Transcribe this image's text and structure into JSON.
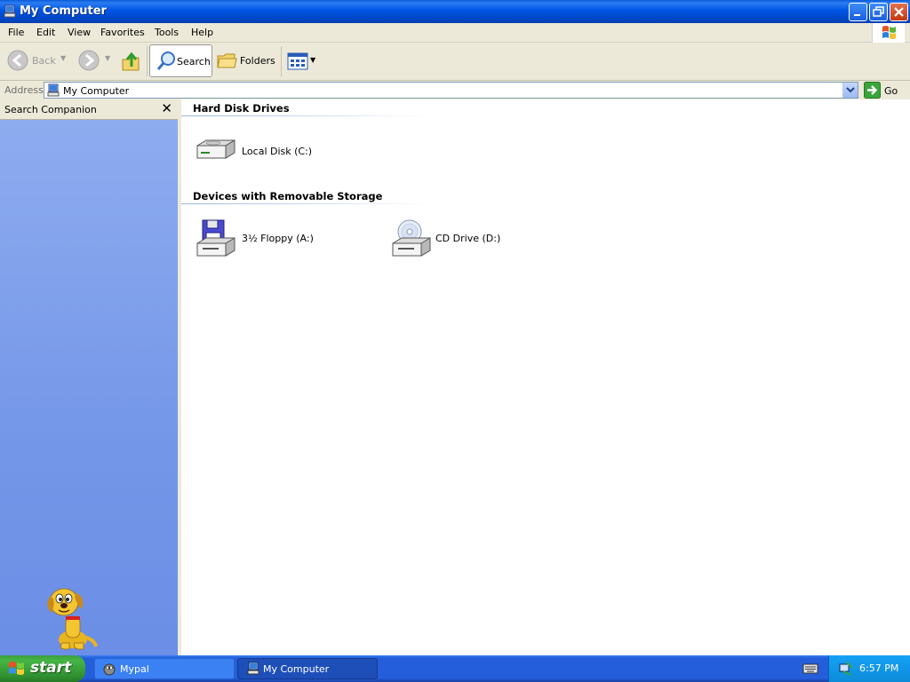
{
  "window": {
    "title": "My Computer",
    "icon": "computer-icon"
  },
  "menu": {
    "items": [
      "File",
      "Edit",
      "View",
      "Favorites",
      "Tools",
      "Help"
    ]
  },
  "toolbar": {
    "back_label": "Back",
    "search_label": "Search",
    "folders_label": "Folders"
  },
  "address": {
    "label": "Address",
    "value": "My Computer",
    "go_label": "Go"
  },
  "left_pane": {
    "title": "Search Companion",
    "close_glyph": "✕"
  },
  "content": {
    "groups": [
      {
        "header": "Hard Disk Drives",
        "items": [
          {
            "label": "Local Disk (C:)",
            "icon": "hard-disk-icon"
          }
        ]
      },
      {
        "header": "Devices with Removable Storage",
        "items": [
          {
            "label": "3½ Floppy (A:)",
            "icon": "floppy-drive-icon"
          },
          {
            "label": "CD Drive (D:)",
            "icon": "cd-drive-icon"
          }
        ]
      }
    ]
  },
  "taskbar": {
    "start_label": "start",
    "tasks": [
      {
        "label": "Mypal",
        "active": false
      },
      {
        "label": "My Computer",
        "active": true
      }
    ],
    "clock": "6:57 PM"
  },
  "colors": {
    "titlebar_blue": "#0055e5",
    "left_pane_blue": "#7597e8",
    "taskbar_blue": "#245edb",
    "start_green": "#3c9f3c",
    "tray_blue": "#0c8bd8"
  }
}
